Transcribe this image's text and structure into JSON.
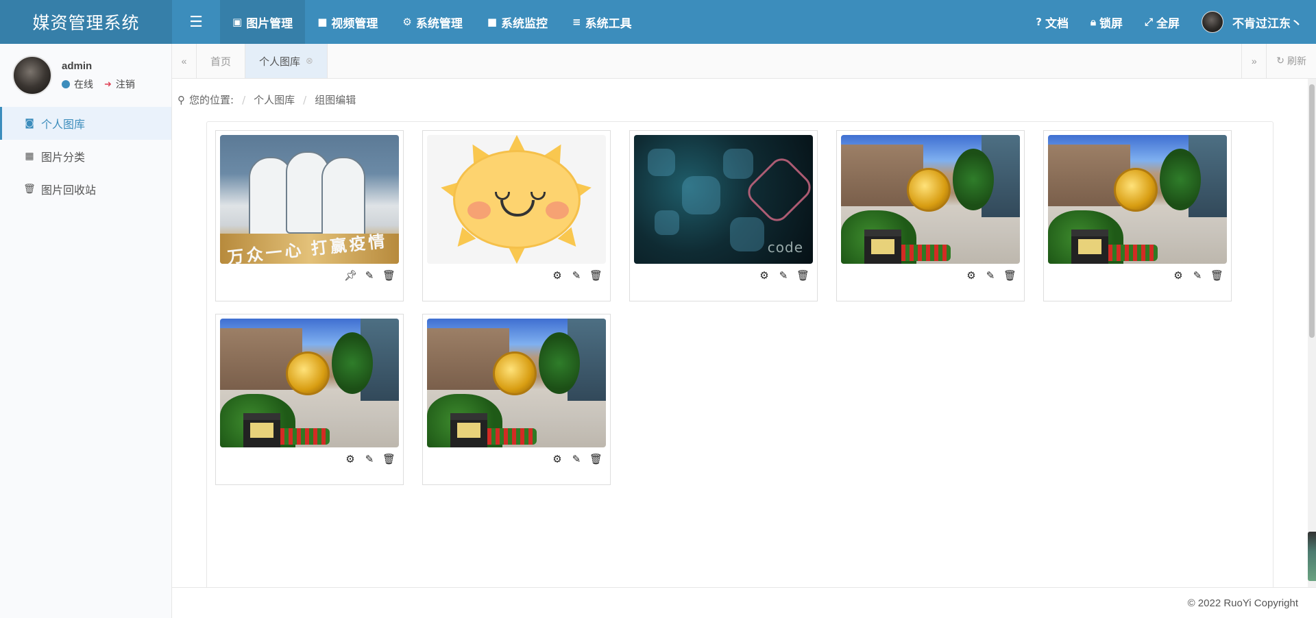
{
  "app": {
    "title": "媒资管理系统"
  },
  "topnav": {
    "items": [
      {
        "label": "图片管理",
        "icon": "image-icon",
        "active": true
      },
      {
        "label": "视频管理",
        "icon": "video-camera-icon",
        "active": false
      },
      {
        "label": "系统管理",
        "icon": "gear-icon",
        "active": false
      },
      {
        "label": "系统监控",
        "icon": "video-camera-icon",
        "active": false
      },
      {
        "label": "系统工具",
        "icon": "list-icon",
        "active": false
      }
    ],
    "right": {
      "docs": "文档",
      "lock": "锁屏",
      "fullscreen": "全屏",
      "username": "不肯过江东丶"
    }
  },
  "sidebar": {
    "user": {
      "name": "admin",
      "status": "在线",
      "logout": "注销"
    },
    "items": [
      {
        "label": "个人图库",
        "icon": "camera-icon",
        "active": true
      },
      {
        "label": "图片分类",
        "icon": "calendar-icon",
        "active": false
      },
      {
        "label": "图片回收站",
        "icon": "trash-icon",
        "active": false
      }
    ]
  },
  "tabs": {
    "items": [
      {
        "label": "首页",
        "active": false
      },
      {
        "label": "个人图库",
        "active": true
      }
    ],
    "refresh": "刷新"
  },
  "breadcrumb": {
    "prefix": "您的位置:",
    "items": [
      "个人图库",
      "组图编辑"
    ]
  },
  "gallery": {
    "images": [
      {
        "subject": "doctors-poster",
        "text": "万众一心 打赢疫情",
        "actions": [
          "pin-icon",
          "edit-icon",
          "trash-icon"
        ]
      },
      {
        "subject": "smiling-sun",
        "actions": [
          "gear-icon",
          "edit-icon",
          "trash-icon"
        ]
      },
      {
        "subject": "code-abstract",
        "text": "code",
        "actions": [
          "gear-icon",
          "edit-icon",
          "trash-icon"
        ]
      },
      {
        "subject": "plaza-medal",
        "actions": [
          "gear-icon",
          "edit-icon",
          "trash-icon"
        ]
      },
      {
        "subject": "plaza-medal",
        "actions": [
          "gear-icon",
          "edit-icon",
          "trash-icon"
        ]
      },
      {
        "subject": "plaza-medal",
        "actions": [
          "gear-icon",
          "edit-icon",
          "trash-icon"
        ]
      },
      {
        "subject": "plaza-medal",
        "actions": [
          "gear-icon",
          "edit-icon",
          "trash-icon"
        ]
      }
    ]
  },
  "footer": {
    "copyright": "© 2022 RuoYi Copyright"
  },
  "colors": {
    "primary": "#3c8dbc",
    "primary_dark": "#367fa9",
    "logout": "#e0475b"
  }
}
